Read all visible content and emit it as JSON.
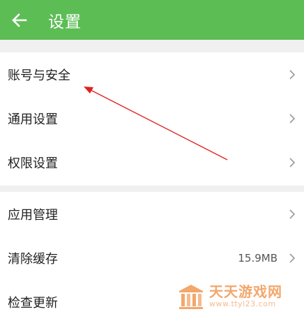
{
  "header": {
    "title": "设置",
    "back_icon": "arrow-left-icon",
    "color": "#5cbd54"
  },
  "groups": [
    {
      "items": [
        {
          "label": "账号与安全"
        },
        {
          "label": "通用设置"
        },
        {
          "label": "权限设置"
        }
      ]
    },
    {
      "items": [
        {
          "label": "应用管理"
        },
        {
          "label": "清除缓存",
          "value": "15.9MB"
        },
        {
          "label": "检查更新"
        }
      ]
    }
  ],
  "annotation": {
    "color": "#e02020"
  },
  "watermark": {
    "name": "天天游戏网",
    "url": "www.ttyl23.com"
  }
}
